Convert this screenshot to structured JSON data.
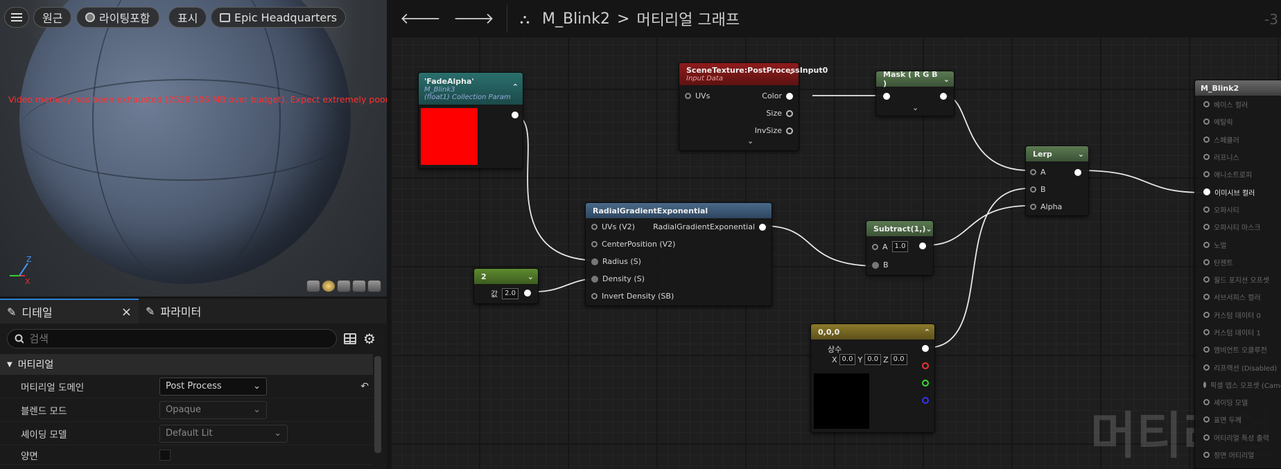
{
  "viewport": {
    "menu_icon": "hamburger-icon",
    "buttons": [
      "원근",
      "라이팅포함",
      "표시",
      "Epic Headquarters"
    ],
    "warning": "Video memory has been exhausted (2528.306 MB over budget). Expect extremely poor performance",
    "axis": {
      "z": "Z",
      "x": "X"
    }
  },
  "details": {
    "tabs": [
      {
        "label": "디테일",
        "icon": "pencil-icon"
      },
      {
        "label": "파라미터",
        "icon": "pencil-icon"
      }
    ],
    "close": "×",
    "search_placeholder": "검색",
    "section": "머티리얼",
    "props": [
      {
        "label": "머티리얼 도메인",
        "value": "Post Process"
      },
      {
        "label": "블렌드 모드",
        "value": "Opaque"
      },
      {
        "label": "셰이딩 모델",
        "value": "Default Lit"
      },
      {
        "label": "양면",
        "value": ""
      }
    ]
  },
  "graph": {
    "breadcrumb_asset": "M_Blink2",
    "breadcrumb_sep": ">",
    "breadcrumb_page": "머티리얼 그래프",
    "zoom": "-3",
    "watermark": "머티리얼",
    "nodes": {
      "fade_alpha": {
        "title": "'FadeAlpha'",
        "sub1": "M_Blink3",
        "sub2": "(float1) Collection Param",
        "color": "#ff0000"
      },
      "scene_texture": {
        "title": "SceneTexture:PostProcessInput0",
        "sub": "Input Data",
        "in": "UVs",
        "outs": [
          "Color",
          "Size",
          "InvSize"
        ]
      },
      "mask": {
        "title": "Mask ( R G B )"
      },
      "lerp": {
        "title": "Lerp",
        "pins": [
          "A",
          "B",
          "Alpha"
        ]
      },
      "radial": {
        "title": "RadialGradientExponential",
        "out": "RadialGradientExponential",
        "ins": [
          "UVs (V2)",
          "CenterPosition (V2)",
          "Radius (S)",
          "Density (S)",
          "Invert Density (SB)"
        ]
      },
      "const2": {
        "title": "2",
        "label": "값",
        "value": "2.0"
      },
      "subtract": {
        "title": "Subtract(1,)",
        "a_label": "A",
        "a_value": "1.0",
        "b_label": "B"
      },
      "vec3": {
        "title": "0,0,0",
        "label": "상수",
        "x": "0.0",
        "y": "0.0",
        "z": "0.0",
        "xl": "X",
        "yl": "Y",
        "zl": "Z"
      },
      "result": {
        "title": "M_Blink2",
        "pins": [
          "베이스 컬러",
          "메탈릭",
          "스페큘러",
          "러프니스",
          "애니소트로피",
          "이미시브 컬러",
          "오파시티",
          "오파시티 마스크",
          "노멀",
          "탄젠트",
          "월드 포지션 오프셋",
          "서브서피스 컬러",
          "커스텀 데이터 0",
          "커스텀 데이터 1",
          "앰비언트 오클루전",
          "리프랙션 (Disabled)",
          "픽셀 뎁스 오프셋 (Camera)",
          "셰이딩 모델",
          "표면 두께",
          "머티리얼 특성 출력",
          "정면 머티리얼"
        ],
        "active_index": 5
      }
    }
  }
}
